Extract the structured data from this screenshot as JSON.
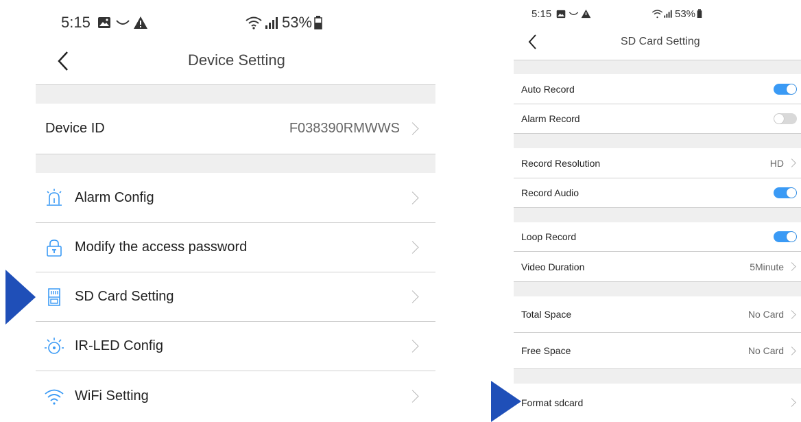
{
  "left_screen": {
    "status": {
      "time": "5:15",
      "battery": "53%"
    },
    "header": {
      "title": "Device Setting"
    },
    "device_id": {
      "label": "Device ID",
      "value": "F038390RMWWS"
    },
    "menu": [
      {
        "label": "Alarm Config",
        "icon": "alarm-light-icon"
      },
      {
        "label": "Modify the access password",
        "icon": "lock-icon"
      },
      {
        "label": "SD Card Setting",
        "icon": "sd-card-icon"
      },
      {
        "label": "IR-LED Config",
        "icon": "ir-led-icon"
      },
      {
        "label": "WiFi Setting",
        "icon": "wifi-icon"
      }
    ]
  },
  "right_screen": {
    "status": {
      "time": "5:15",
      "battery": "53%"
    },
    "header": {
      "title": "SD Card Setting"
    },
    "rows": {
      "auto_record": {
        "label": "Auto Record",
        "on": true
      },
      "alarm_record": {
        "label": "Alarm Record",
        "on": false
      },
      "record_resolution": {
        "label": "Record Resolution",
        "value": "HD"
      },
      "record_audio": {
        "label": "Record Audio",
        "on": true
      },
      "loop_record": {
        "label": "Loop Record",
        "on": true
      },
      "video_duration": {
        "label": "Video Duration",
        "value": "5Minute"
      },
      "total_space": {
        "label": "Total Space",
        "value": "No Card"
      },
      "free_space": {
        "label": "Free Space",
        "value": "No Card"
      },
      "format_sdcard": {
        "label": "Format sdcard"
      }
    }
  },
  "colors": {
    "accent": "#3a9af5",
    "toggle_off": "#d9d9d9",
    "pointer": "#1f4fb8",
    "band": "#efefef"
  }
}
